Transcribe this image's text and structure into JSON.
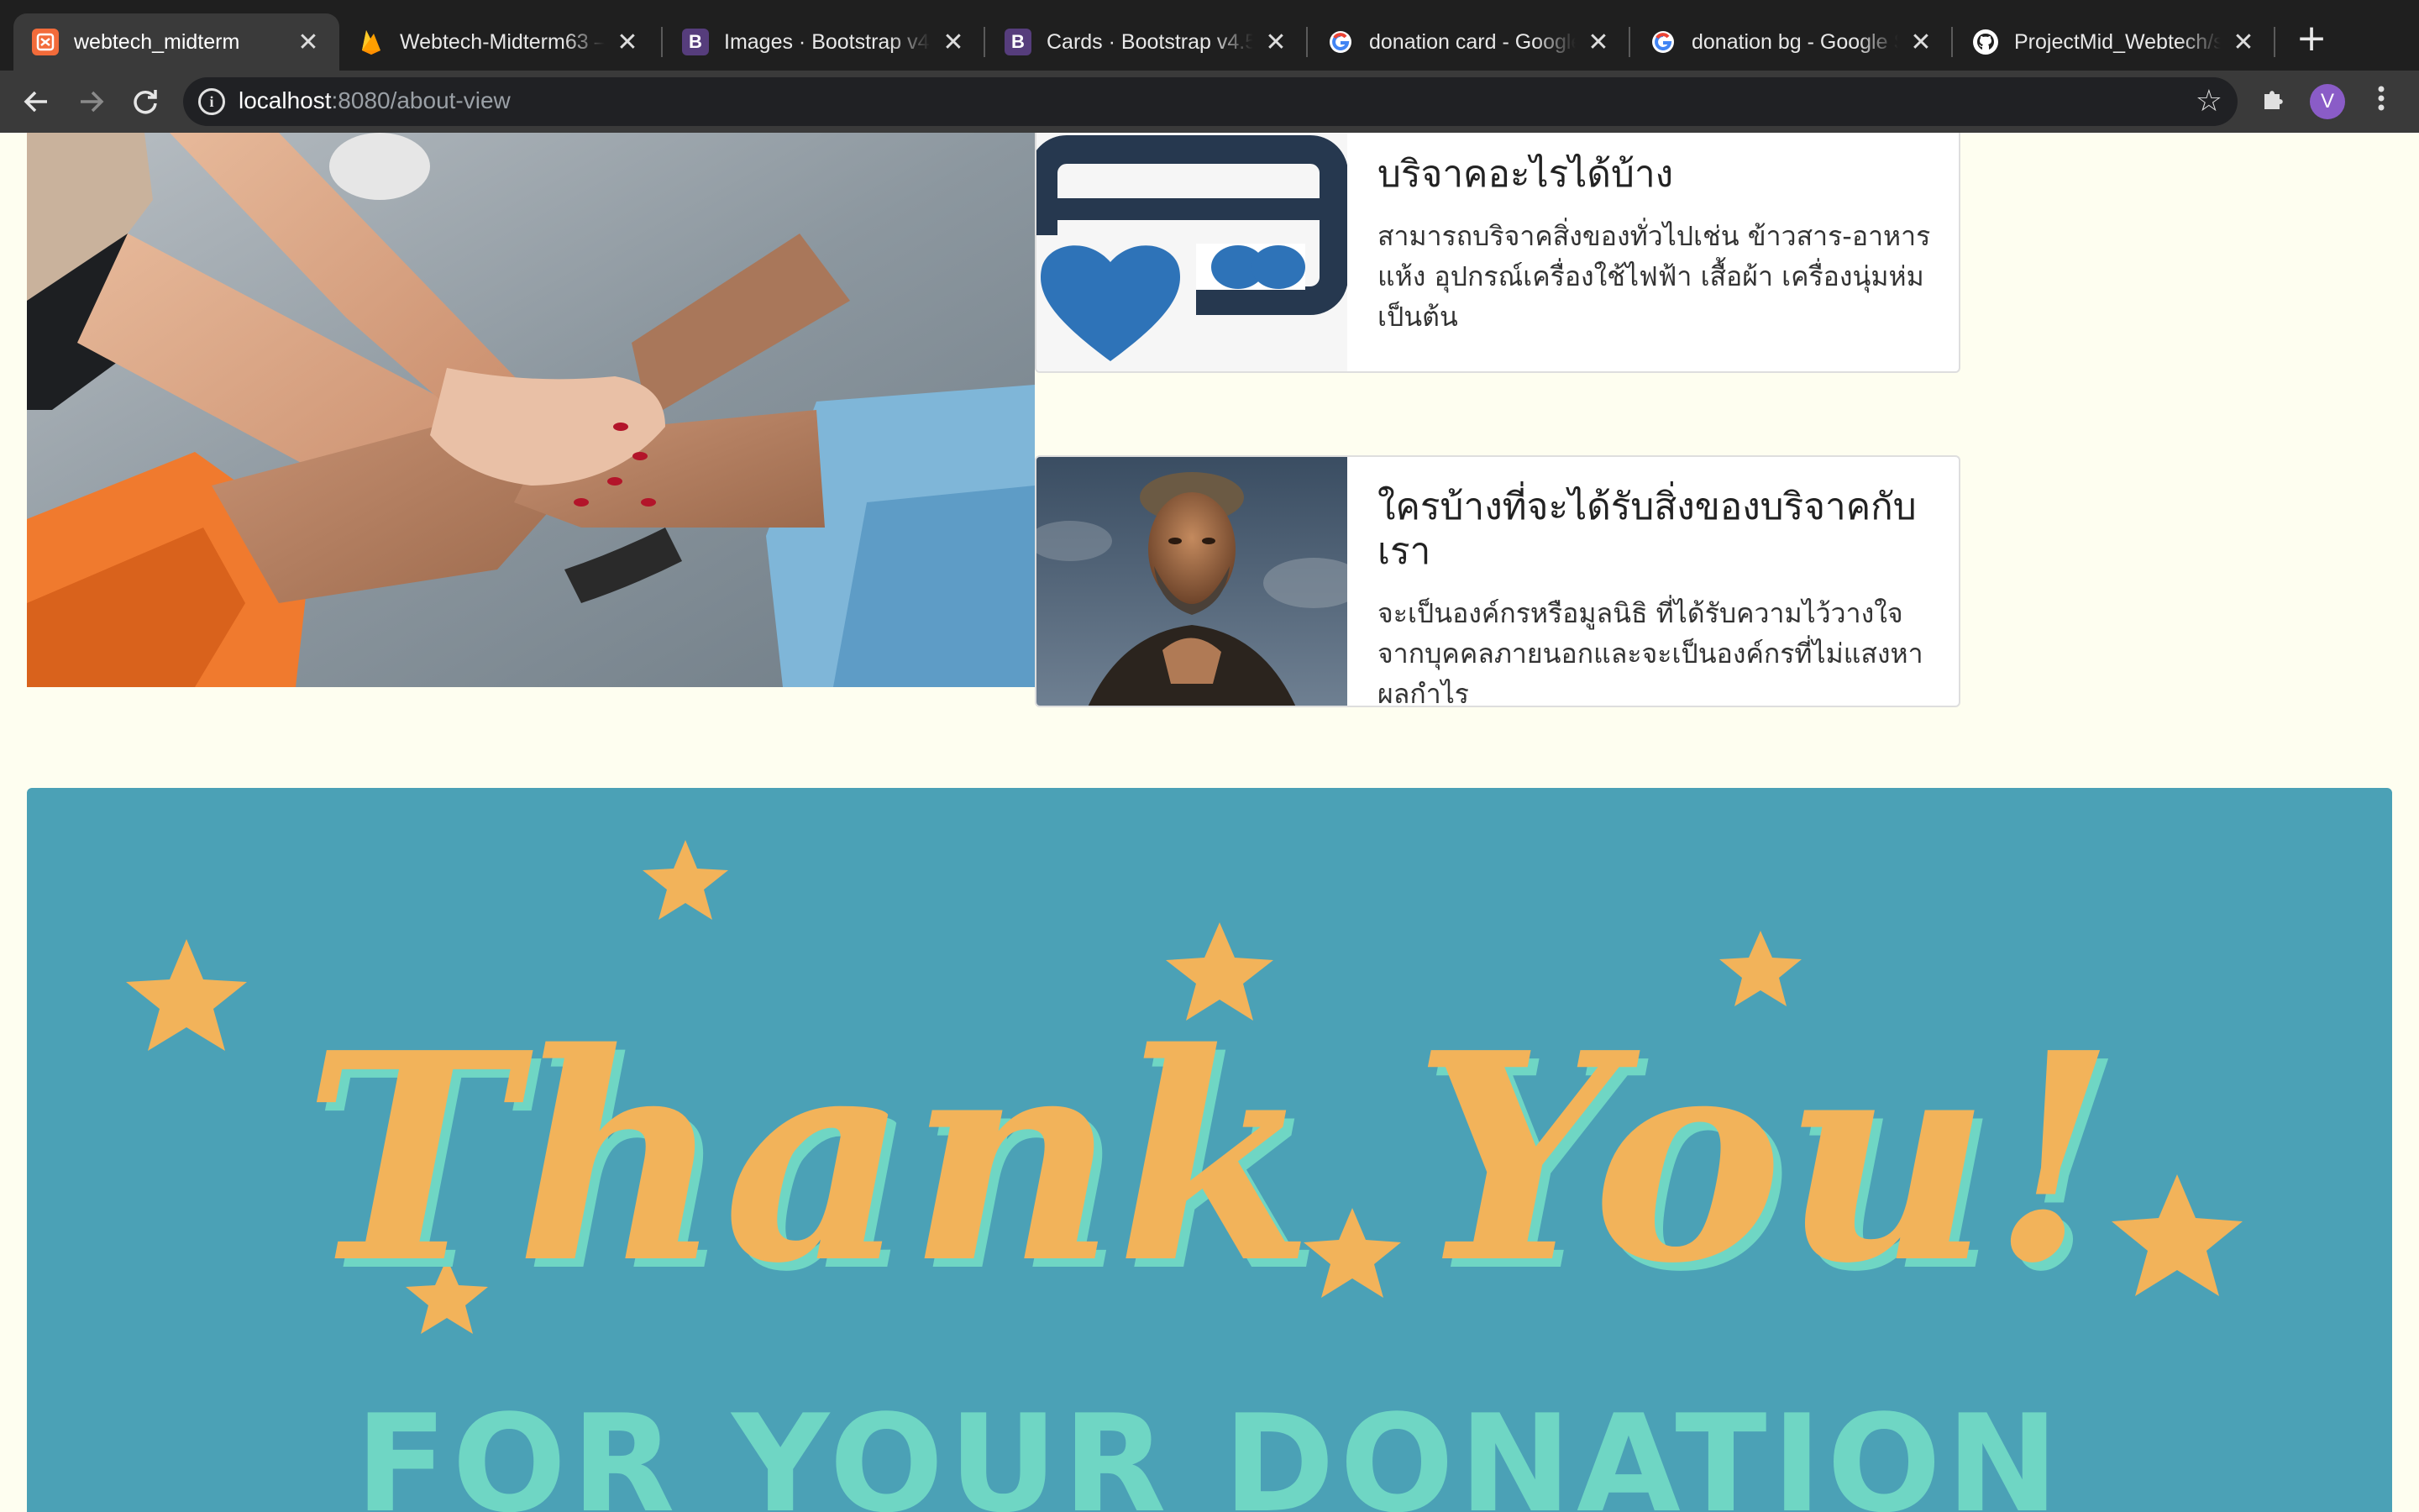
{
  "browser": {
    "tabs": [
      {
        "title": "webtech_midterm",
        "icon": "xampp-icon",
        "active": true
      },
      {
        "title": "Webtech-Midterm63 –",
        "icon": "firebase-icon",
        "active": false
      },
      {
        "title": "Images · Bootstrap v4.",
        "icon": "bootstrap-icon",
        "active": false
      },
      {
        "title": "Cards · Bootstrap v4.5",
        "icon": "bootstrap-icon",
        "active": false
      },
      {
        "title": "donation card - Google",
        "icon": "google-icon",
        "active": false
      },
      {
        "title": "donation bg - Google S",
        "icon": "google-icon",
        "active": false
      },
      {
        "title": "ProjectMid_Webtech/s",
        "icon": "github-icon",
        "active": false
      }
    ],
    "close_glyph": "✕",
    "new_tab_glyph": "+",
    "address": {
      "host": "localhost",
      "path": ":8080/about-view"
    },
    "profile_initial": "V",
    "colors": {
      "tabbar": "#1f1f1f",
      "toolbar": "#3a3a3a",
      "omnibox": "#202124",
      "avatar": "#8a5cc7"
    }
  },
  "page": {
    "cards": [
      {
        "title": "บริจาคอะไรได้บ้าง",
        "text": "สามารถบริจาคสิ่งของทั่วไปเช่น ข้าวสาร-อาหารแห้ง อุปกรณ์เครื่องใช้ไฟฟ้า เสื้อผ้า เครื่องนุ่มห่มเป็นต้น",
        "image": "donation-card-heart-icon"
      },
      {
        "title": "ใครบ้างที่จะได้รับสิ่งของบริจาคกับเรา",
        "text": "จะเป็นองค์กรหรือมูลนิธิ ที่ได้รับความไว้วางใจจากบุคคลภายนอกและจะเป็นองค์กรที่ไม่แสงหาผลกำไร",
        "image": "elderly-man-photo"
      }
    ],
    "banner": {
      "line1": "Thank You!",
      "line2": "FOR YOUR DONATION",
      "colors": {
        "background": "#4ba1b6",
        "script": "#f2b35a",
        "shadow": "#6fd6c4",
        "stars": "#f2b35a"
      }
    },
    "hero_image": "hands-together-photo"
  }
}
